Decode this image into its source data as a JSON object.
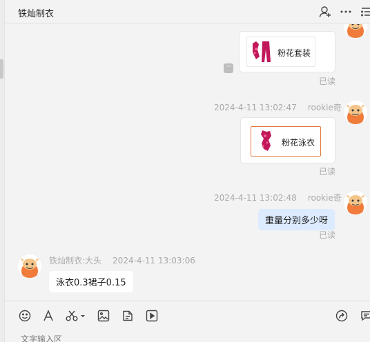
{
  "header": {
    "title": "铁灿制衣",
    "icons": [
      "add-member-icon",
      "more-icon",
      "list-icon"
    ]
  },
  "messages": [
    {
      "type": "product-card",
      "direction": "out",
      "label": "粉花套装",
      "read_status": "已读"
    },
    {
      "type": "product-card",
      "direction": "out",
      "time": "2024-4-11 13:02:47",
      "sender": "rookie奇",
      "label": "粉花泳衣",
      "read_status": "已读"
    },
    {
      "type": "text",
      "direction": "out",
      "time": "2024-4-11 13:02:48",
      "sender": "rookie奇",
      "text": "重量分别多少呀",
      "read_status": "已读"
    },
    {
      "type": "text",
      "direction": "in",
      "sender": "铁灿制衣:大头",
      "time": "2024-4-11 13:03:06",
      "text": "泳衣0.3裙子0.15"
    }
  ],
  "toolbar": {
    "icons": [
      "emoji-icon",
      "font-icon",
      "scissors-icon",
      "image-icon",
      "file-icon",
      "video-icon",
      "share-icon",
      "quick-reply-icon"
    ]
  },
  "input": {
    "placeholder": "文字输入区"
  },
  "colors": {
    "my_bubble": "#dcebff",
    "avatar_orange": "#f07b3a",
    "selected_card_border": "#e07a3c",
    "product_pink": "#c2185b"
  }
}
